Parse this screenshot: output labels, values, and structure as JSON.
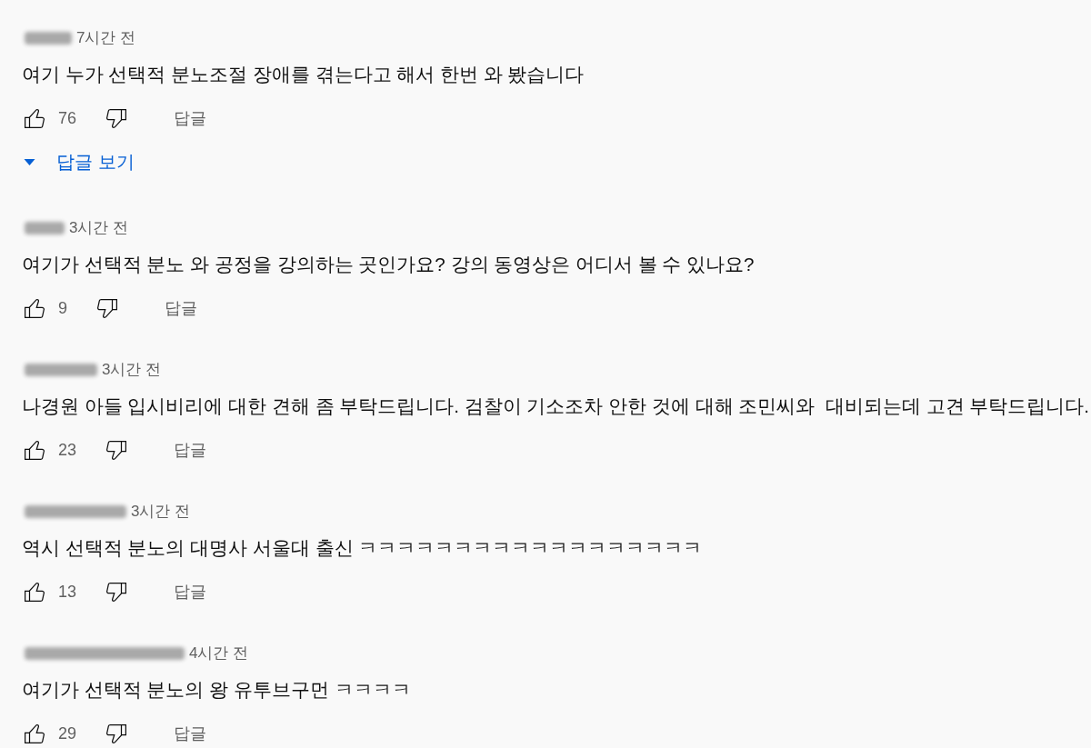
{
  "comments": [
    {
      "author_hidden": true,
      "time": "7시간 전",
      "text": "여기 누가 선택적 분노조절 장애를 겪는다고 해서 한번 와 봤습니다",
      "likes": "76",
      "reply": "답글",
      "view_replies": "답글 보기"
    },
    {
      "author_hidden": true,
      "time": "3시간 전",
      "text": "여기가 선택적 분노 와 공정을 강의하는 곳인가요? 강의 동영상은 어디서 볼 수 있나요?",
      "likes": "9",
      "reply": "답글"
    },
    {
      "author_hidden": true,
      "time": "3시간 전",
      "text": "나경원 아들 입시비리에 대한 견해 좀 부탁드립니다. 검찰이 기소조차 안한 것에 대해 조민씨와  대비되는데 고견 부탁드립니다.",
      "likes": "23",
      "reply": "답글"
    },
    {
      "author_hidden": true,
      "time": "3시간 전",
      "text": "역시 선택적 분노의 대명사 서울대 출신 ㅋㅋㅋㅋㅋㅋㅋㅋㅋㅋㅋㅋㅋㅋㅋㅋㅋㅋ",
      "likes": "13",
      "reply": "답글"
    },
    {
      "author_hidden": true,
      "time": "4시간 전",
      "text": "여기가 선택적 분노의 왕 유투브구먼 ㅋㅋㅋㅋ",
      "likes": "29",
      "reply": "답글"
    }
  ]
}
